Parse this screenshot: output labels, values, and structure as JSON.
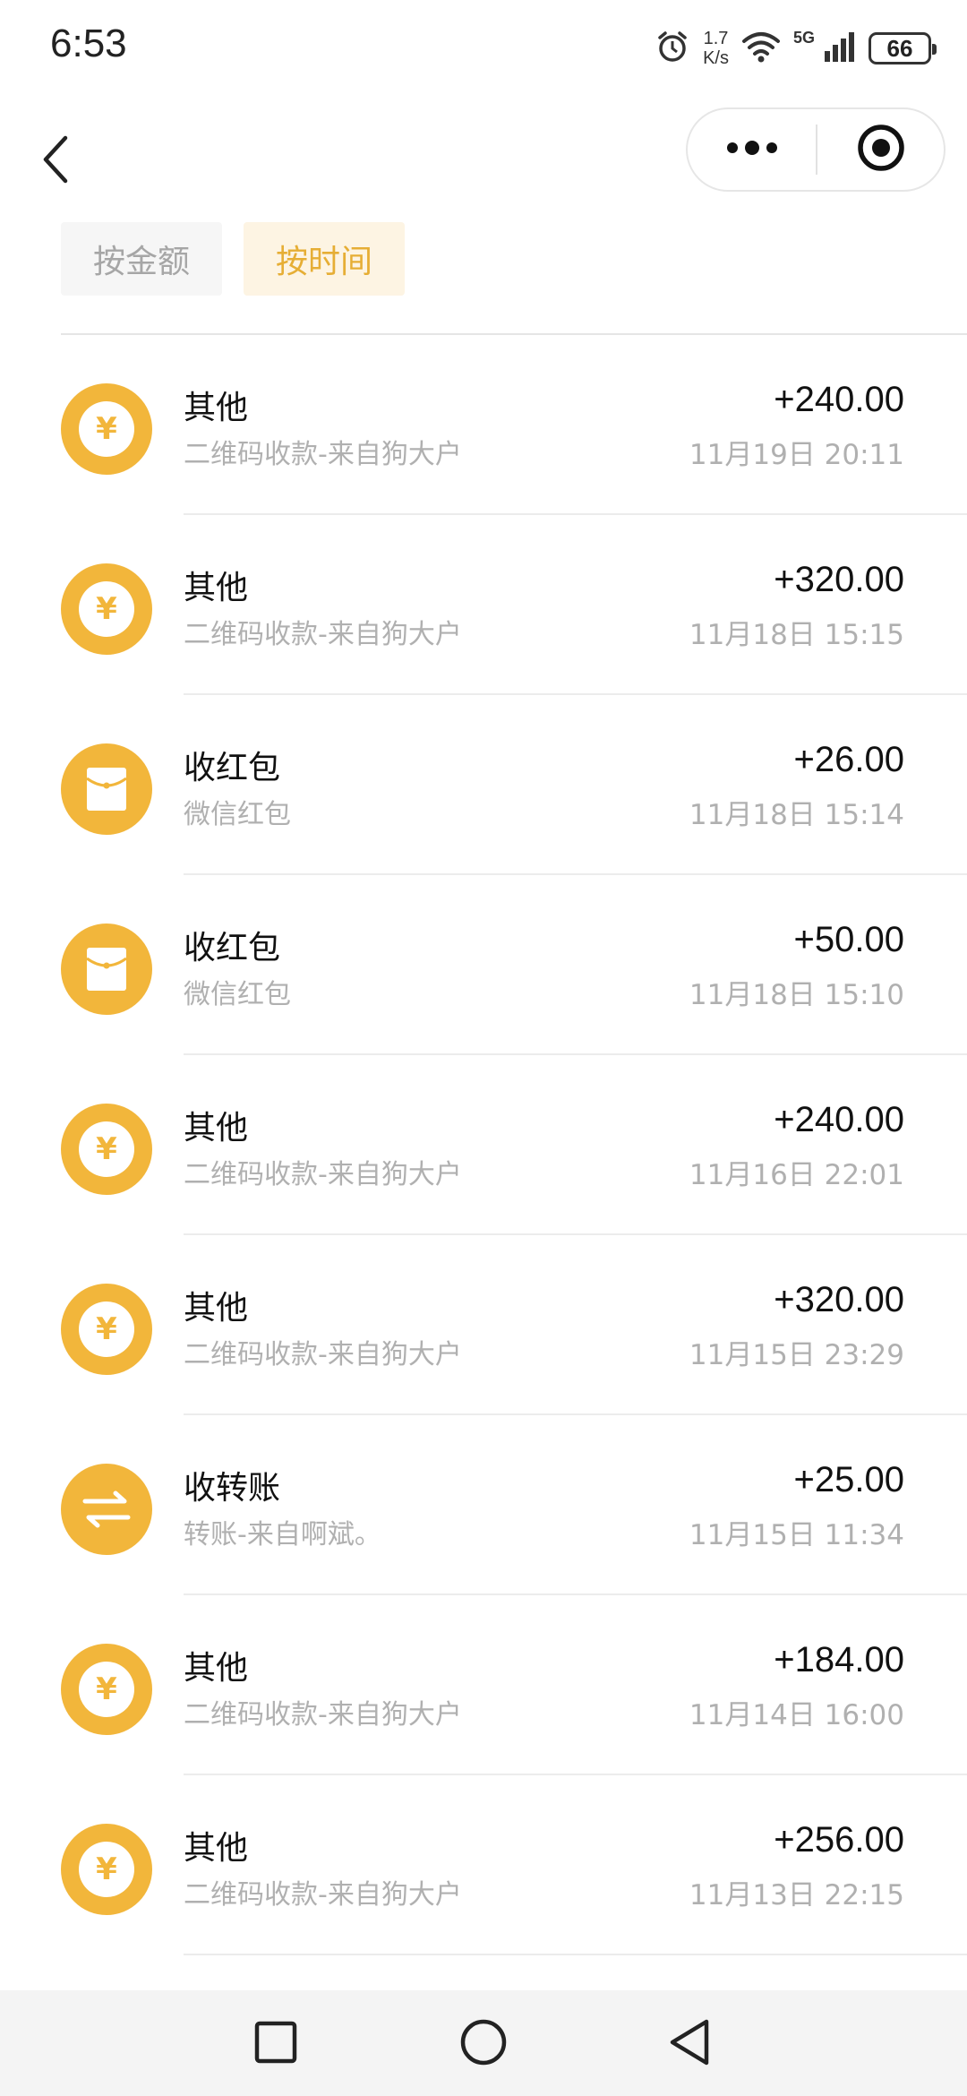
{
  "status_bar": {
    "time": "6:53",
    "net_speed_value": "1.7",
    "net_speed_unit": "K/s",
    "network": "5G",
    "battery": "66"
  },
  "nav": {
    "back_icon": "chevron-left-icon",
    "more_icon": "more-dots-icon",
    "close_icon": "target-circle-icon"
  },
  "filters": {
    "by_amount": "按金额",
    "by_time": "按时间",
    "active_color": "#e6ae35"
  },
  "colors": {
    "accent": "#f2b63b",
    "secondary_text": "#b0b0b0"
  },
  "transactions": [
    {
      "icon": "yuan-coin-icon",
      "title": "其他",
      "subtitle": "二维码收款-来自狗大户",
      "amount": "+240.00",
      "time": "11月19日 20:11"
    },
    {
      "icon": "yuan-coin-icon",
      "title": "其他",
      "subtitle": "二维码收款-来自狗大户",
      "amount": "+320.00",
      "time": "11月18日 15:15"
    },
    {
      "icon": "red-envelope-icon",
      "title": "收红包",
      "subtitle": "微信红包",
      "amount": "+26.00",
      "time": "11月18日 15:14"
    },
    {
      "icon": "red-envelope-icon",
      "title": "收红包",
      "subtitle": "微信红包",
      "amount": "+50.00",
      "time": "11月18日 15:10"
    },
    {
      "icon": "yuan-coin-icon",
      "title": "其他",
      "subtitle": "二维码收款-来自狗大户",
      "amount": "+240.00",
      "time": "11月16日 22:01"
    },
    {
      "icon": "yuan-coin-icon",
      "title": "其他",
      "subtitle": "二维码收款-来自狗大户",
      "amount": "+320.00",
      "time": "11月15日 23:29"
    },
    {
      "icon": "transfer-arrows-icon",
      "title": "收转账",
      "subtitle": "转账-来自啊斌。",
      "amount": "+25.00",
      "time": "11月15日 11:34"
    },
    {
      "icon": "yuan-coin-icon",
      "title": "其他",
      "subtitle": "二维码收款-来自狗大户",
      "amount": "+184.00",
      "time": "11月14日 16:00"
    },
    {
      "icon": "yuan-coin-icon",
      "title": "其他",
      "subtitle": "二维码收款-来自狗大户",
      "amount": "+256.00",
      "time": "11月13日 22:15"
    }
  ],
  "system_nav": {
    "recents_icon": "square-recents-icon",
    "home_icon": "circle-home-icon",
    "back_icon": "triangle-back-icon"
  }
}
